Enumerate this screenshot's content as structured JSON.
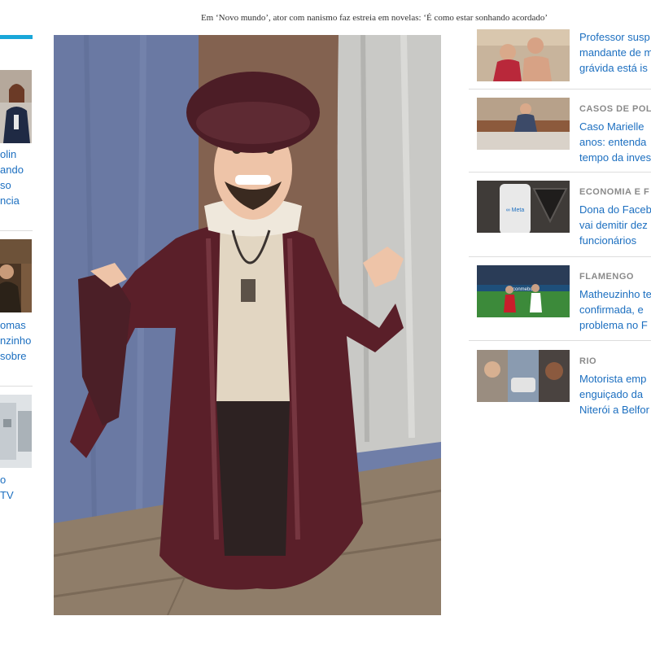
{
  "main": {
    "headline": "Em ‘Novo mundo’, ator com nanismo faz estreia em novelas: ‘É como estar sonhando acordado’"
  },
  "left_column": {
    "story1": [
      "olin",
      "ando",
      "so",
      "ncia"
    ],
    "story2": [
      "omas",
      "nzinho",
      "sobre"
    ],
    "story3": [
      "o",
      "TV"
    ]
  },
  "right_column": {
    "items": [
      {
        "category": "",
        "lines": [
          "Professor susp",
          "mandante de m",
          "grávida está is"
        ]
      },
      {
        "category": "CASOS DE POL",
        "lines": [
          "Caso Marielle",
          "anos: entenda",
          "tempo da inves"
        ]
      },
      {
        "category": "ECONOMIA E F",
        "lines": [
          "Dona do Faceb",
          "vai demitir dez",
          "funcionários"
        ]
      },
      {
        "category": "FLAMENGO",
        "lines": [
          "Matheuzinho te",
          "confirmada, e",
          "problema no F"
        ]
      },
      {
        "category": "RIO",
        "lines": [
          "Motorista emp",
          "enguiçado da",
          "Niterói a Belfor"
        ]
      }
    ]
  },
  "thumb_text": {
    "meta_logo": "∞ Meta",
    "conmebol": "conmebol"
  },
  "colors": {
    "accent": "#1aa7d9",
    "link": "#1c6fc0",
    "category": "#8a8a8a"
  }
}
